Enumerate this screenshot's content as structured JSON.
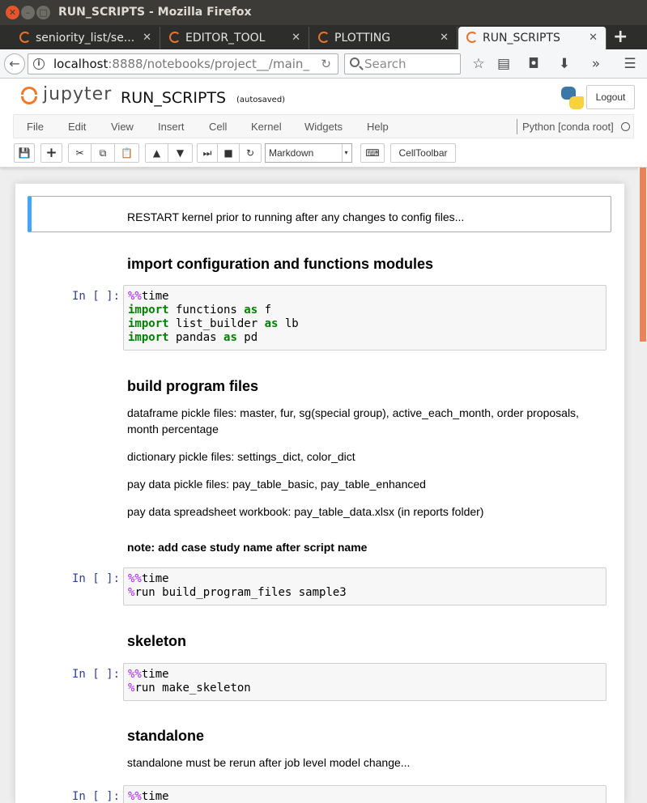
{
  "window": {
    "title": "RUN_SCRIPTS - Mozilla Firefox",
    "close_glyph": "✕",
    "min_glyph": "–",
    "max_glyph": "□"
  },
  "tabs": [
    {
      "label": "seniority_list/se...",
      "close": "✕"
    },
    {
      "label": "EDITOR_TOOL",
      "close": "✕"
    },
    {
      "label": "PLOTTING",
      "close": "✕"
    },
    {
      "label": "RUN_SCRIPTS",
      "close": "✕"
    }
  ],
  "new_tab_glyph": "+",
  "nav": {
    "back_glyph": "←",
    "info_glyph": "i",
    "url_host": "localhost",
    "url_path": ":8888/notebooks/project__/main_",
    "reload_glyph": "↻",
    "search_placeholder": "Search",
    "bookmark_glyph": "☆",
    "reader_glyph": "▤",
    "pocket_glyph": "◘",
    "download_glyph": "⬇",
    "overflow_glyph": "»",
    "menu_glyph": "☰"
  },
  "jupyter": {
    "logo_text": "jupyter",
    "notebook_name": "RUN_SCRIPTS",
    "autosave": "(autosaved)",
    "logout_label": "Logout",
    "menus": [
      "File",
      "Edit",
      "View",
      "Insert",
      "Cell",
      "Kernel",
      "Widgets",
      "Help"
    ],
    "kernel_name": "Python [conda root]",
    "cell_type": "Markdown",
    "cell_type_caret": "▾",
    "celltoolbar_label": "CellToolbar",
    "toolbar_icons": {
      "save": "💾",
      "add": "+",
      "cut": "✂",
      "copy": "⧉",
      "paste": "📋",
      "up": "▲",
      "down": "▼",
      "run": "⏭",
      "stop": "■",
      "restart": "↻",
      "keyboard": "⌨"
    }
  },
  "cells": {
    "selected_md": "RESTART kernel prior to running after any changes to config files...",
    "h_import": "import configuration and functions modules",
    "prompt": "In [ ]:",
    "code1": {
      "l1_magic": "%%",
      "l1_rest": "time",
      "l2_kw": "import",
      "l2_mid": " functions ",
      "l2_as": "as",
      "l2_end": " f",
      "l3_kw": "import",
      "l3_mid": " list_builder ",
      "l3_as": "as",
      "l3_end": " lb",
      "l4_kw": "import",
      "l4_mid": " pandas ",
      "l4_as": "as",
      "l4_end": " pd"
    },
    "h_build": "build program files",
    "p1": "dataframe pickle files: master, fur, sg(special group), active_each_month, order proposals, month percentage",
    "p2": "dictionary pickle files: settings_dict, color_dict",
    "p3": "pay data pickle files: pay_table_basic, pay_table_enhanced",
    "p4": "pay data spreadsheet workbook: pay_table_data.xlsx (in reports folder)",
    "note": "note: add case study name after script name",
    "code2": {
      "l1_magic": "%%",
      "l1_rest": "time",
      "l2_magic": "%",
      "l2_rest": "run build_program_files sample3"
    },
    "h_skeleton": "skeleton",
    "code3": {
      "l1_magic": "%%",
      "l1_rest": "time",
      "l2_magic": "%",
      "l2_rest": "run make_skeleton"
    },
    "h_standalone": "standalone",
    "p_standalone": "standalone must be rerun after job level model change...",
    "code4": {
      "l1_magic": "%%",
      "l1_rest": "time"
    }
  }
}
